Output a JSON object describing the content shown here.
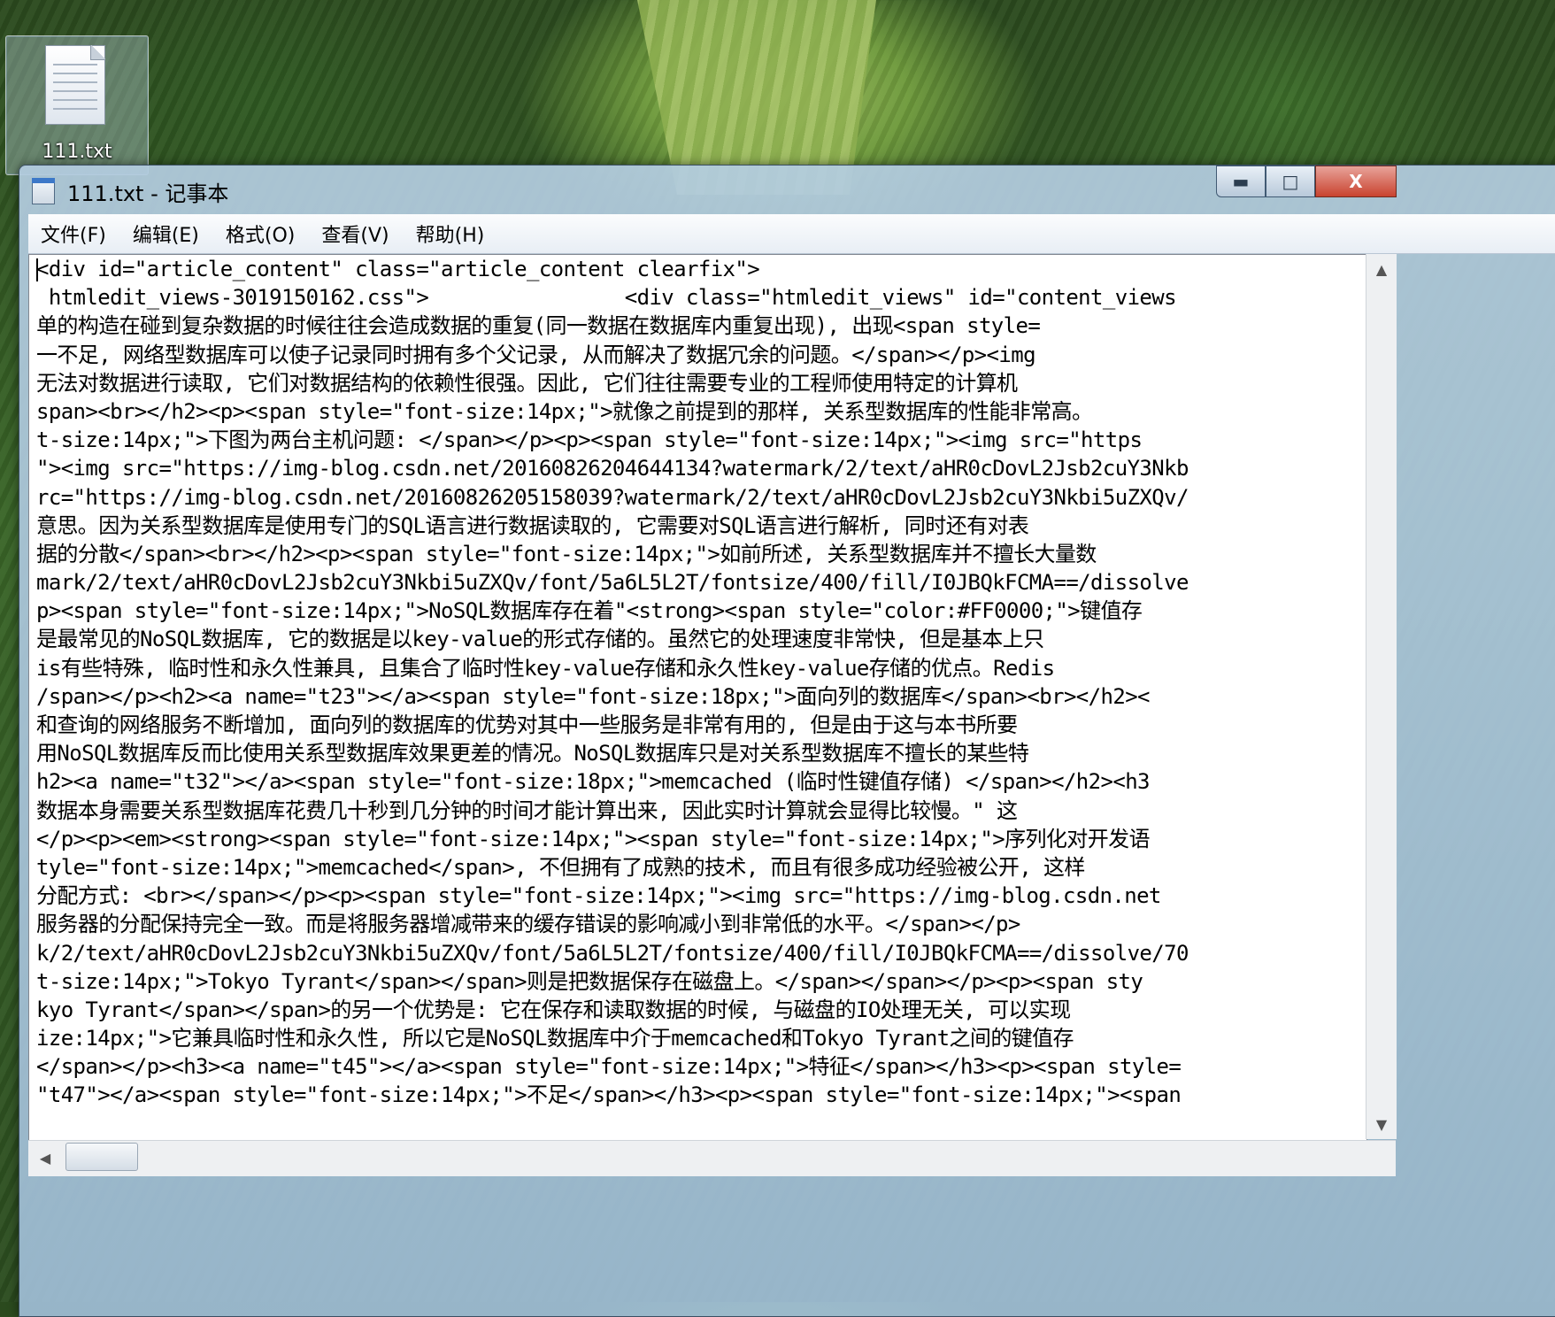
{
  "desktop": {
    "icon_label": "111.txt"
  },
  "window": {
    "title": "111.txt - 记事本",
    "controls": {
      "minimize": "▬",
      "maximize": "□",
      "close": "X"
    }
  },
  "menu": [
    "文件(F)",
    "编辑(E)",
    "格式(O)",
    "查看(V)",
    "帮助(H)"
  ],
  "editor": {
    "lines": [
      "<div id=\"article_content\" class=\"article_content clearfix\">",
      " htmledit_views-3019150162.css\">                <div class=\"htmledit_views\" id=\"content_views",
      "单的构造在碰到复杂数据的时候往往会造成数据的重复(同一数据在数据库内重复出现), 出现<span style=",
      "一不足, 网络型数据库可以使子记录同时拥有多个父记录, 从而解决了数据冗余的问题。</span></p><img",
      "无法对数据进行读取, 它们对数据结构的依赖性很强。因此, 它们往往需要专业的工程师使用特定的计算机",
      "span><br></h2><p><span style=\"font-size:14px;\">就像之前提到的那样, 关系型数据库的性能非常高。",
      "t-size:14px;\">下图为两台主机问题: </span></p><p><span style=\"font-size:14px;\"><img src=\"https",
      "\"><img src=\"https://img-blog.csdn.net/20160826204644134?watermark/2/text/aHR0cDovL2Jsb2cuY3Nkb",
      "rc=\"https://img-blog.csdn.net/20160826205158039?watermark/2/text/aHR0cDovL2Jsb2cuY3Nkbi5uZXQv/",
      "意思。因为关系型数据库是使用专门的SQL语言进行数据读取的, 它需要对SQL语言进行解析, 同时还有对表",
      "据的分散</span><br></h2><p><span style=\"font-size:14px;\">如前所述, 关系型数据库并不擅长大量数",
      "mark/2/text/aHR0cDovL2Jsb2cuY3Nkbi5uZXQv/font/5a6L5L2T/fontsize/400/fill/I0JBQkFCMA==/dissolve",
      "p><span style=\"font-size:14px;\">NoSQL数据库存在着\"<strong><span style=\"color:#FF0000;\">键值存",
      "是最常见的NoSQL数据库, 它的数据是以key-value的形式存储的。虽然它的处理速度非常快, 但是基本上只",
      "is有些特殊, 临时性和永久性兼具, 且集合了临时性key-value存储和永久性key-value存储的优点。Redis",
      "/span></p><h2><a name=\"t23\"></a><span style=\"font-size:18px;\">面向列的数据库</span><br></h2><",
      "和查询的网络服务不断增加, 面向列的数据库的优势对其中一些服务是非常有用的, 但是由于这与本书所要",
      "用NoSQL数据库反而比使用关系型数据库效果更差的情况。NoSQL数据库只是对关系型数据库不擅长的某些特",
      "h2><a name=\"t32\"></a><span style=\"font-size:18px;\">memcached (临时性键值存储) </span></h2><h3",
      "数据本身需要关系型数据库花费几十秒到几分钟的时间才能计算出来, 因此实时计算就会显得比较慢。\" 这",
      "</p><p><em><strong><span style=\"font-size:14px;\"><span style=\"font-size:14px;\">序列化对开发语",
      "tyle=\"font-size:14px;\">memcached</span>, 不但拥有了成熟的技术, 而且有很多成功经验被公开, 这样",
      "分配方式: <br></span></p><p><span style=\"font-size:14px;\"><img src=\"https://img-blog.csdn.net",
      "服务器的分配保持完全一致。而是将服务器增减带来的缓存错误的影响减小到非常低的水平。</span></p>",
      "k/2/text/aHR0cDovL2Jsb2cuY3Nkbi5uZXQv/font/5a6L5L2T/fontsize/400/fill/I0JBQkFCMA==/dissolve/70",
      "t-size:14px;\">Tokyo Tyrant</span></span>则是把数据保存在磁盘上。</span></span></p><p><span sty",
      "kyo Tyrant</span></span>的另一个优势是: 它在保存和读取数据的时候, 与磁盘的IO处理无关, 可以实现",
      "ize:14px;\">它兼具临时性和永久性, 所以它是NoSQL数据库中介于memcached和Tokyo Tyrant之间的键值存",
      "</span></p><h3><a name=\"t45\"></a><span style=\"font-size:14px;\">特征</span></h3><p><span style=",
      "\"t47\"></a><span style=\"font-size:14px;\">不足</span></h3><p><span style=\"font-size:14px;\"><span"
    ]
  }
}
